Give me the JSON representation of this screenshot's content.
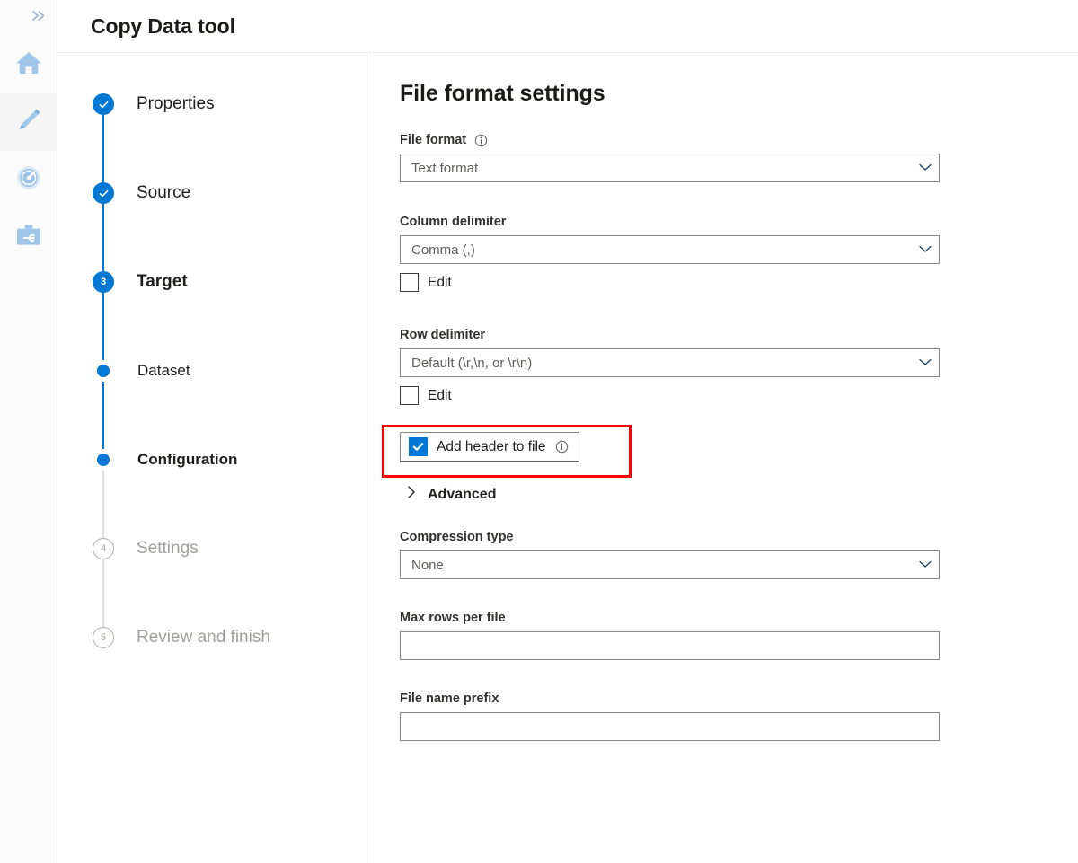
{
  "rail": {
    "collapse_icon": "double-chevron-right-icon",
    "items": [
      {
        "icon": "home-icon",
        "name": "home",
        "active": false
      },
      {
        "icon": "pencil-icon",
        "name": "author",
        "active": true
      },
      {
        "icon": "gauge-icon",
        "name": "monitor",
        "active": false
      },
      {
        "icon": "toolbox-icon",
        "name": "manage",
        "active": false
      }
    ]
  },
  "header": {
    "title": "Copy Data tool"
  },
  "steps": [
    {
      "label": "Properties",
      "marker": "check",
      "state": "done",
      "level": "top"
    },
    {
      "label": "Source",
      "marker": "check",
      "state": "done",
      "level": "top"
    },
    {
      "label": "Target",
      "marker": "3",
      "state": "current",
      "level": "top"
    },
    {
      "label": "Dataset",
      "marker": "dot",
      "state": "done",
      "level": "sub"
    },
    {
      "label": "Configuration",
      "marker": "dot",
      "state": "current",
      "level": "sub"
    },
    {
      "label": "Settings",
      "marker": "4",
      "state": "pending",
      "level": "top"
    },
    {
      "label": "Review and finish",
      "marker": "5",
      "state": "pending",
      "level": "top"
    }
  ],
  "form": {
    "heading": "File format settings",
    "file_format": {
      "label": "File format",
      "info_icon": "info-icon",
      "value": "Text format",
      "chevron": "chevron-down-icon"
    },
    "column_delimiter": {
      "label": "Column delimiter",
      "value": "Comma (,)",
      "chevron": "chevron-down-icon",
      "edit_label": "Edit",
      "edit_checked": false
    },
    "row_delimiter": {
      "label": "Row delimiter",
      "value": "Default (\\r,\\n, or \\r\\n)",
      "chevron": "chevron-down-icon",
      "edit_label": "Edit",
      "edit_checked": false
    },
    "add_header": {
      "label": "Add header to file",
      "checked": true,
      "info_icon": "info-icon"
    },
    "advanced": {
      "label": "Advanced",
      "chevron": "chevron-right-icon",
      "expanded": false
    },
    "compression_type": {
      "label": "Compression type",
      "value": "None",
      "chevron": "chevron-down-icon"
    },
    "max_rows_per_file": {
      "label": "Max rows per file",
      "value": "",
      "placeholder": ""
    },
    "file_name_prefix": {
      "label": "File name prefix",
      "value": "",
      "placeholder": ""
    }
  },
  "annotation": {
    "type": "red-highlight-rectangle",
    "color": "#ff0000",
    "target": "Add header to file"
  },
  "colors": {
    "accent": "#0078d4",
    "annotation": "#ff0000",
    "border": "#8a8886",
    "text": "#201f1e",
    "dim_text": "#a19f9d"
  }
}
